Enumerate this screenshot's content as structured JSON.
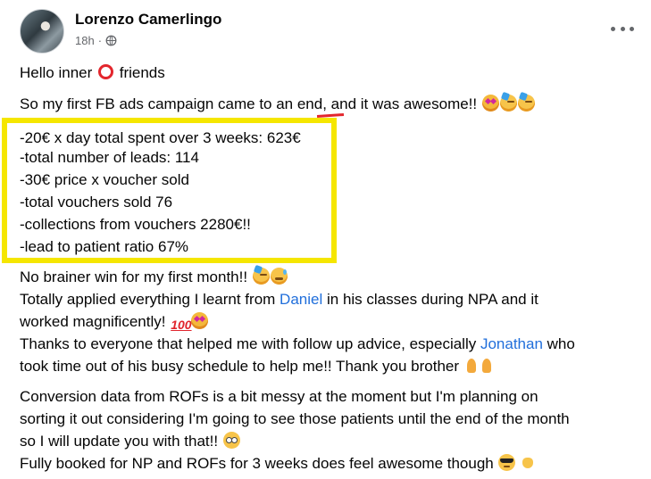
{
  "post": {
    "author": "Lorenzo Camerlingo",
    "time": "18h",
    "separator": "·",
    "privacy_icon": "globe-icon",
    "more_icon": "more-options-icon"
  },
  "lines": {
    "greeting_a": "Hello inner",
    "greeting_b": "friends",
    "intro": "So my first FB ads campaign came to an end, and it was awesome!!",
    "stat1": "-20€ x day total spent over 3 weeks: 623€",
    "stat2": "-total number of leads: 114",
    "stat3": "-30€ price x voucher sold",
    "stat4": "-total vouchers sold 76",
    "stat5": "-collections from vouchers 2280€!!",
    "stat6": "-lead to patient ratio 67%",
    "win": "No brainer win for my first month!!",
    "applied_a": "Totally applied everything I learnt from",
    "applied_link": "Daniel",
    "applied_b": "in his classes during NPA and it",
    "worked": "worked magnificently!",
    "emoji_100": "100",
    "thanks_a": "Thanks to everyone that helped me with follow up advice, especially",
    "thanks_link": "Jonathan",
    "thanks_b": "who",
    "took": "took time out of his busy schedule to help me!! Thank you brother",
    "conv1": "Conversion data from ROFs is a bit messy at the moment but I'm planning on",
    "conv2": "sorting it out considering I'm going to see those patients until the end of the month",
    "conv3": "so I will update you with that!!",
    "booked": "Fully booked for NP and ROFs for 3 weeks does feel awesome though"
  },
  "colors": {
    "highlight": "#f5e600",
    "link": "#216fdb",
    "ring": "#e3262d"
  }
}
